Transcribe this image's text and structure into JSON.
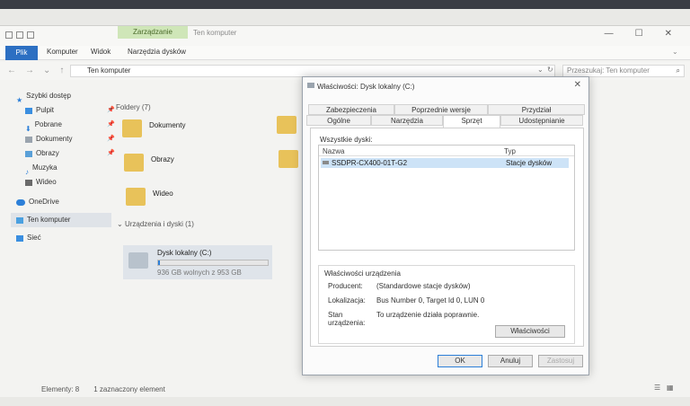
{
  "explorer": {
    "context_tab": "Zarządzanie",
    "window_title": "Ten komputer",
    "tabs": [
      "Plik",
      "Komputer",
      "Widok",
      "Narzędzia dysków"
    ],
    "address": "Ten komputer",
    "search_placeholder": "Przeszukaj: Ten komputer",
    "sidebar": [
      {
        "label": "Szybki dostęp",
        "icon": "star-icon"
      },
      {
        "label": "Pulpit",
        "icon": "desktop-icon",
        "pinned": true
      },
      {
        "label": "Pobrane",
        "icon": "download-icon",
        "pinned": true
      },
      {
        "label": "Dokumenty",
        "icon": "document-icon",
        "pinned": true
      },
      {
        "label": "Obrazy",
        "icon": "picture-icon",
        "pinned": true
      },
      {
        "label": "Muzyka",
        "icon": "music-icon"
      },
      {
        "label": "Wideo",
        "icon": "video-icon"
      },
      {
        "label": "OneDrive",
        "icon": "cloud-icon"
      },
      {
        "label": "Ten komputer",
        "icon": "computer-icon",
        "selected": true
      },
      {
        "label": "Sieć",
        "icon": "network-icon"
      }
    ],
    "folders_header": "Foldery (7)",
    "folders": [
      "Dokumenty",
      "Obrazy",
      "Wideo"
    ],
    "devices_header": "Urządzenia i dyski (1)",
    "drive": {
      "name": "Dysk lokalny (C:)",
      "free_text": "936 GB wolnych z 953 GB",
      "used_fraction": 0.018
    },
    "status": {
      "count": "Elementy: 8",
      "selected": "1 zaznaczony element"
    }
  },
  "dialog": {
    "title": "Właściwości: Dysk lokalny (C:)",
    "tabs_row1": [
      "Zabezpieczenia",
      "Poprzednie wersje",
      "Przydział"
    ],
    "tabs_row2": [
      "Ogólne",
      "Narzędzia",
      "Sprzęt",
      "Udostępnianie"
    ],
    "all_disks_label": "Wszystkie dyski:",
    "col_name": "Nazwa",
    "col_type": "Typ",
    "disk_name": "SSDPR-CX400-01T-G2",
    "disk_type": "Stacje dysków",
    "props_header": "Właściwości urządzenia",
    "manufacturer_label": "Producent:",
    "manufacturer_value": "(Standardowe stacje dysków)",
    "location_label": "Lokalizacja:",
    "location_value": "Bus Number 0, Target Id 0, LUN 0",
    "state_label": "Stan urządzenia:",
    "state_value": "To urządzenie działa poprawnie.",
    "properties_button": "Właściwości",
    "ok_button": "OK",
    "cancel_button": "Anuluj",
    "apply_button": "Zastosuj"
  }
}
